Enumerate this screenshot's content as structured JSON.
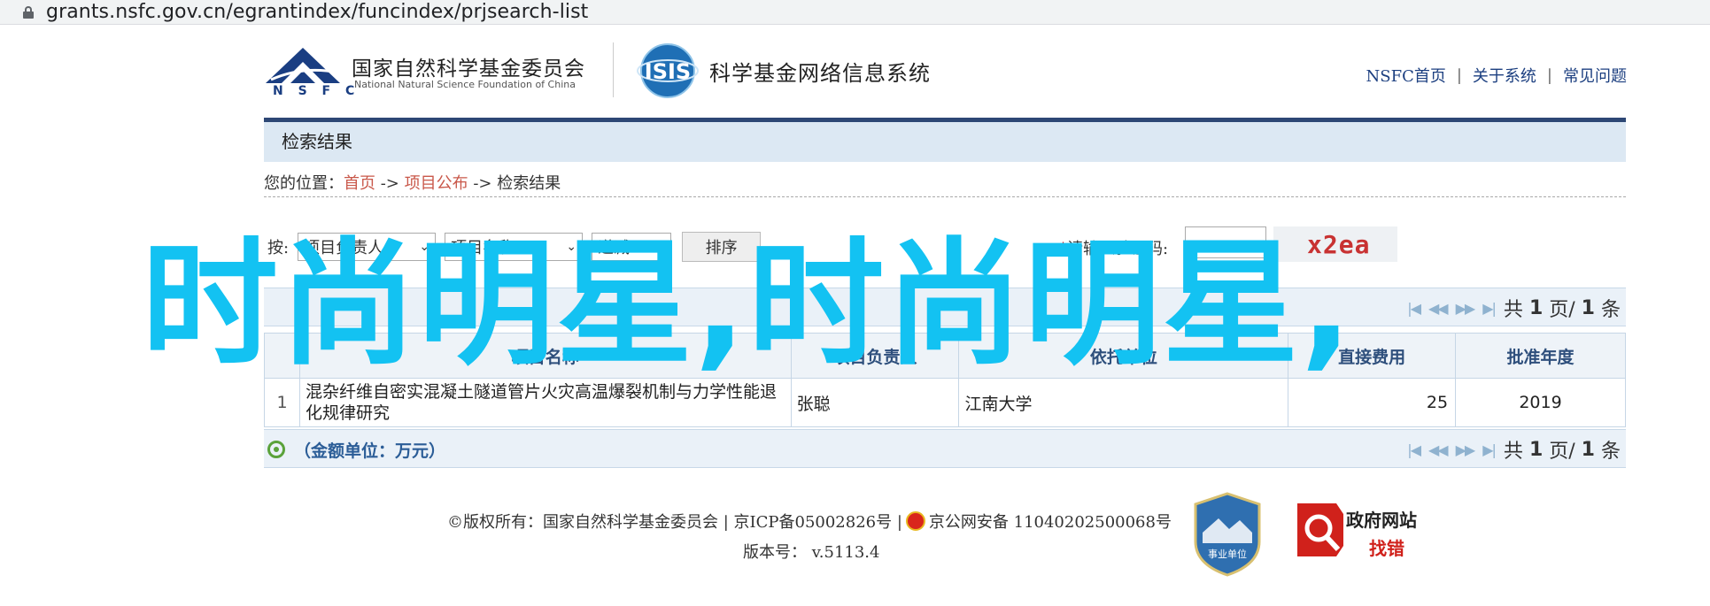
{
  "browser": {
    "url": "grants.nsfc.gov.cn/egrantindex/funcindex/prjsearch-list"
  },
  "header": {
    "nsfc_logo_text": "N S F C",
    "org_cn": "国家自然科学基金委员会",
    "org_en": "National Natural Science Foundation of China",
    "isis_logo_text": "ISIS",
    "system_name": "科学基金网络信息系统",
    "links": [
      "NSFC首页",
      "关于系统",
      "常见问题"
    ]
  },
  "main": {
    "result_title": "检索结果",
    "breadcrumb": {
      "prefix": "您的位置：",
      "items": [
        "首页",
        "项目公布",
        "检索结果"
      ],
      "separator": " -> "
    },
    "sort": {
      "label": "按:",
      "field1": "项目负责人",
      "field2": "项目名称",
      "order": "递减",
      "button": "排序"
    },
    "captcha": {
      "label": "请输入验证码:",
      "required_mark": "*",
      "value": "",
      "image_text": "x2ea"
    },
    "pager": {
      "nav_icons": "first-prev-next-last",
      "text_prefix": "共",
      "page_current": "1",
      "text_mid": "页/",
      "total": "1",
      "text_suffix": "条"
    },
    "table": {
      "headers": [
        "",
        "项目名称",
        "项目负责人",
        "依托单位",
        "直接费用",
        "批准年度"
      ],
      "rows": [
        [
          "1",
          "混杂纤维自密实混凝土隧道管片火灾高温爆裂机制与力学性能退化规律研究",
          "张聪",
          "江南大学",
          "25",
          "2019"
        ]
      ]
    },
    "amount_unit": "（金额单位：万元）"
  },
  "footer": {
    "copyright": "©版权所有：国家自然科学基金委员会 | 京ICP备05002826号 |",
    "police_record": "京公网安备 11040202500068号",
    "version_label": "版本号：",
    "version": "v.5113.4",
    "badge_text": "事业单位",
    "gov_site_title": "政府网站",
    "gov_site_sub": "找错"
  },
  "overlay": {
    "text": "时尚明星,时尚明星,"
  },
  "colors": {
    "overlay": "#13c2f2",
    "header_bar": "#2d4775",
    "link": "#1c3f80",
    "crumb_link": "#c9584a"
  }
}
